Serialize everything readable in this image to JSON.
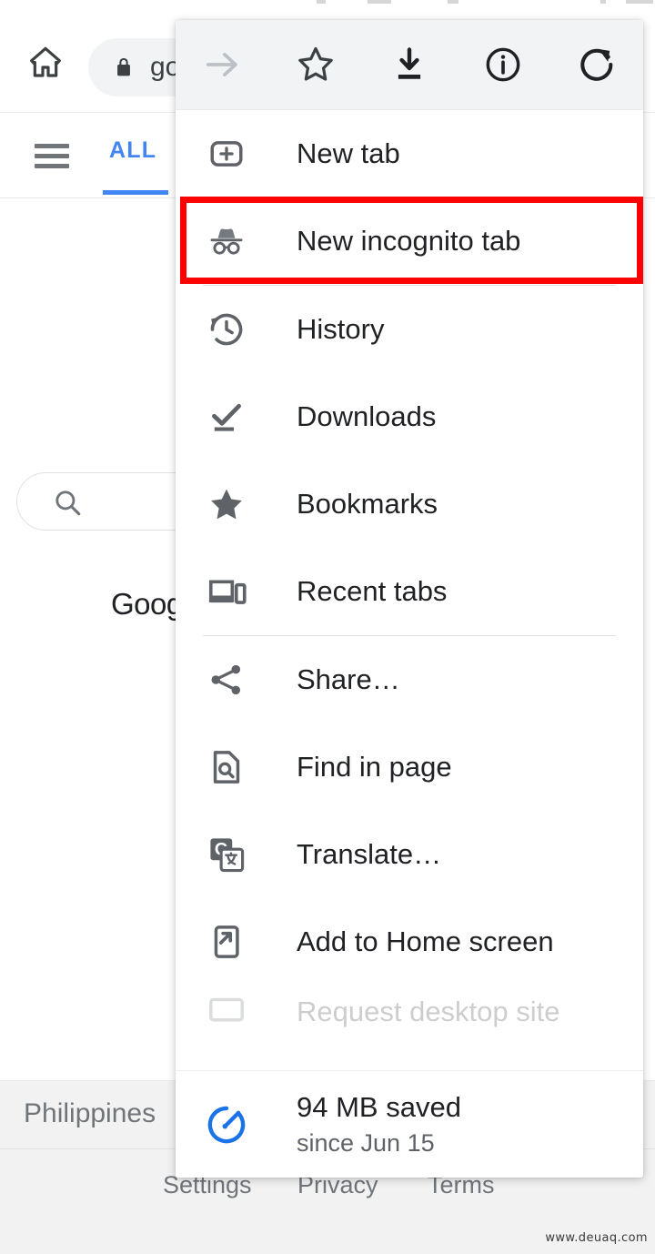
{
  "browser": {
    "home_icon": "home-icon",
    "omnibox": {
      "lock_icon": "lock-icon",
      "url_text": "go"
    }
  },
  "page": {
    "menu_icon": "hamburger-icon",
    "tab_label": "ALL",
    "search_icon": "search-icon",
    "logo_text": "Googl",
    "country": "Philippines",
    "footer_links": [
      "Settings",
      "Privacy",
      "Terms"
    ]
  },
  "watermark": "www.deuaq.com",
  "menu": {
    "toolbar": [
      {
        "name": "forward-arrow-icon",
        "label": "Forward",
        "enabled": false
      },
      {
        "name": "star-icon",
        "label": "Bookmark",
        "enabled": true
      },
      {
        "name": "download-icon",
        "label": "Download page",
        "enabled": true
      },
      {
        "name": "info-icon",
        "label": "Page info",
        "enabled": true
      },
      {
        "name": "reload-icon",
        "label": "Reload",
        "enabled": true
      }
    ],
    "items": [
      {
        "label": "New tab",
        "icon": "new-tab-icon",
        "highlighted": false
      },
      {
        "label": "New incognito tab",
        "icon": "incognito-icon",
        "highlighted": true
      },
      {
        "label": "History",
        "icon": "history-icon",
        "highlighted": false
      },
      {
        "label": "Downloads",
        "icon": "downloads-icon",
        "highlighted": false
      },
      {
        "label": "Bookmarks",
        "icon": "bookmarks-star-icon",
        "highlighted": false
      },
      {
        "label": "Recent tabs",
        "icon": "recent-tabs-icon",
        "highlighted": false
      },
      {
        "label": "Share…",
        "icon": "share-icon",
        "highlighted": false
      },
      {
        "label": "Find in page",
        "icon": "find-in-page-icon",
        "highlighted": false
      },
      {
        "label": "Translate…",
        "icon": "translate-icon",
        "highlighted": false
      },
      {
        "label": "Add to Home screen",
        "icon": "add-to-home-screen-icon",
        "highlighted": false
      },
      {
        "label": "Request desktop site",
        "icon": "desktop-site-icon",
        "highlighted": false
      }
    ],
    "data_saver": {
      "icon": "speedometer-icon",
      "amount": "94 MB saved",
      "since": "since Jun 15"
    },
    "highlight_color": "#ff0000"
  }
}
